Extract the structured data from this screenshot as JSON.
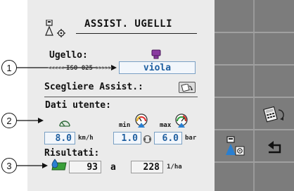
{
  "header": {
    "title": "ASSIST. UGELLI"
  },
  "nozzle": {
    "label": "Ugello:",
    "standard": "ISO 025",
    "color_name": "viola",
    "color_hex": "#8a3aa0"
  },
  "assist": {
    "label": "Scegliere Assist.:"
  },
  "user_data": {
    "label": "Dati utente:",
    "speed": {
      "value": "8.0",
      "unit": "km/h"
    },
    "pressure_min": {
      "label": "min",
      "value": "1.0"
    },
    "pressure_max": {
      "label": "max",
      "value": "6.0"
    },
    "pressure_unit": "bar"
  },
  "results": {
    "label": "Risultati:",
    "area": {
      "value": "93",
      "unit": "a"
    },
    "rate": {
      "value": "228",
      "unit": "1/ha"
    }
  },
  "callouts": [
    "1",
    "2",
    "3"
  ],
  "sidebar": {
    "buttons": [
      "calculator-icon",
      "nozzle-settings-icon",
      "return-icon"
    ]
  },
  "colors": {
    "panel": "#ebebeb",
    "sidebar": "#7c7c7c",
    "field_text": "#1f5fa0",
    "accent_blue": "#2a7fd0",
    "accent_green": "#3aa03a"
  }
}
